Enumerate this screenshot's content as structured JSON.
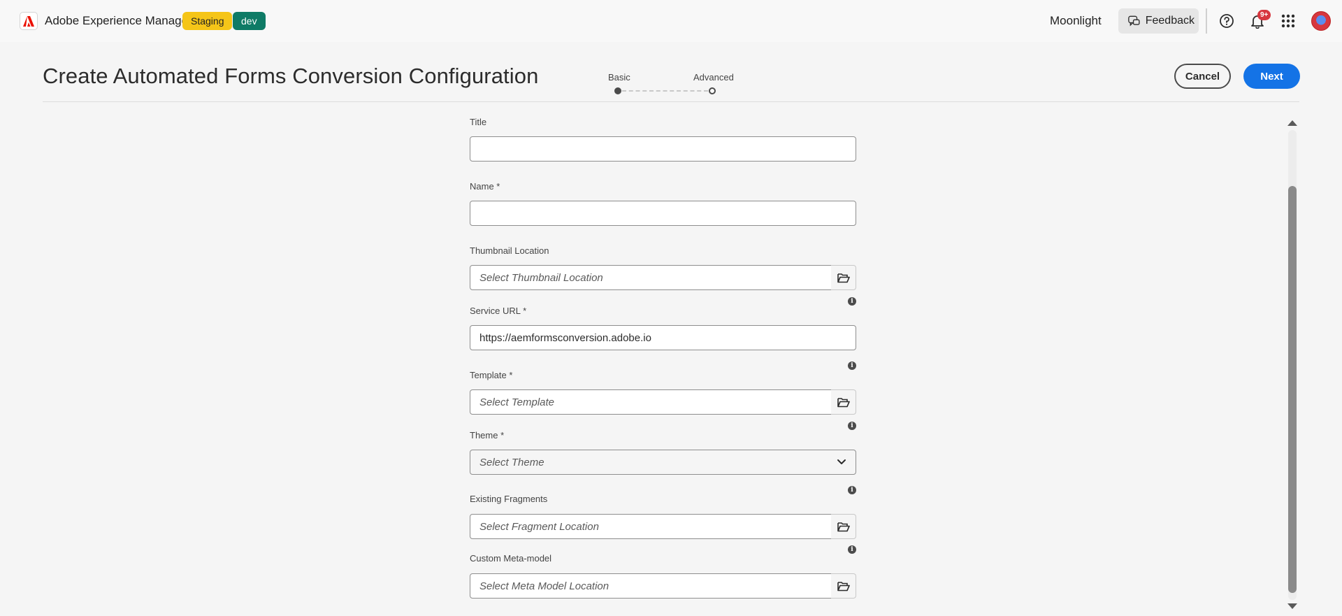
{
  "shell": {
    "brand": "Adobe Experience Manager",
    "env_badge": "Staging",
    "env_badge_color": "#f5c518",
    "program_badge": "dev",
    "program_badge_color": "#0f7b66",
    "org_name": "Moonlight",
    "feedback_label": "Feedback",
    "notification_count": "9+",
    "icons": [
      "adobe-logo-icon",
      "feedback-icon",
      "help-icon",
      "bell-icon",
      "apps-grid-icon",
      "avatar"
    ]
  },
  "header": {
    "title": "Create Automated Forms Conversion Configuration",
    "steps": [
      {
        "label": "Basic",
        "state": "current"
      },
      {
        "label": "Advanced",
        "state": "upcoming"
      }
    ],
    "cancel_label": "Cancel",
    "next_label": "Next",
    "accent_color": "#1473e6"
  },
  "form": {
    "title": {
      "label": "Title",
      "value": ""
    },
    "name": {
      "label": "Name *",
      "value": ""
    },
    "thumbnail": {
      "label": "Thumbnail Location",
      "placeholder": "Select Thumbnail Location"
    },
    "service_url": {
      "label": "Service URL *",
      "value": "https://aemformsconversion.adobe.io"
    },
    "template": {
      "label": "Template *",
      "placeholder": "Select Template"
    },
    "theme": {
      "label": "Theme *",
      "placeholder": "Select Theme"
    },
    "fragments": {
      "label": "Existing Fragments",
      "placeholder": "Select Fragment Location"
    },
    "meta_model": {
      "label": "Custom Meta-model",
      "placeholder": "Select Meta Model Location"
    },
    "info_glyph": "i"
  }
}
